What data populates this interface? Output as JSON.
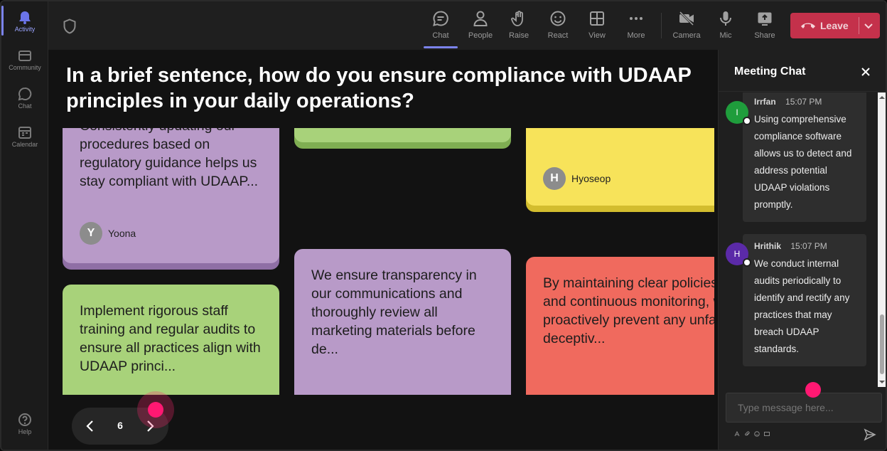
{
  "rail": {
    "items": [
      {
        "label": "Activity",
        "icon": "bell-icon",
        "active": true
      },
      {
        "label": "Community",
        "icon": "community-icon"
      },
      {
        "label": "Chat",
        "icon": "chat-icon"
      },
      {
        "label": "Calendar",
        "icon": "calendar-icon"
      }
    ],
    "help": {
      "label": "Help",
      "icon": "help-icon"
    }
  },
  "toolbar": {
    "buttons": [
      {
        "label": "Chat",
        "icon": "chat-icon",
        "active": true
      },
      {
        "label": "People",
        "icon": "people-icon"
      },
      {
        "label": "Raise",
        "icon": "raise-hand-icon"
      },
      {
        "label": "React",
        "icon": "smiley-icon"
      },
      {
        "label": "View",
        "icon": "grid-icon"
      },
      {
        "label": "More",
        "icon": "more-icon"
      },
      {
        "label": "Camera",
        "icon": "camera-off-icon"
      },
      {
        "label": "Mic",
        "icon": "mic-icon"
      },
      {
        "label": "Share",
        "icon": "share-icon"
      }
    ],
    "leave_label": "Leave"
  },
  "question": "In a brief sentence, how do you ensure compliance with UDAAP principles in your daily operations?",
  "cards": [
    {
      "text": "Consistently updating our procedures based on regulatory guidance helps us stay compliant with UDAAP...",
      "author_initial": "Y",
      "author": "Yoona",
      "color": "#b89ac8"
    },
    {
      "text": "",
      "color": "#a8d27a"
    },
    {
      "text": "",
      "author_initial": "H",
      "author": "Hyoseop",
      "color": "#f7e35a"
    },
    {
      "text": "Implement rigorous staff training and regular audits to ensure all practices align with UDAAP princi...",
      "color": "#a8d27a"
    },
    {
      "text": "We ensure transparency in our communications and thoroughly review all marketing materials before de...",
      "color": "#b89ac8"
    },
    {
      "text": "By maintaining clear policies and continuous monitoring, we proactively prevent any unfair, deceptiv...",
      "color": "#f06a5e"
    }
  ],
  "pager": {
    "page": "6"
  },
  "chat": {
    "title": "Meeting Chat",
    "messages": [
      {
        "initial": "I",
        "name": "Irrfan",
        "time": "15:07 PM",
        "text": "Using comprehensive compliance software allows us to detect and address potential UDAAP violations promptly.",
        "avatar_color": "#1f9d3c"
      },
      {
        "initial": "H",
        "name": "Hrithik",
        "time": "15:07 PM",
        "text": "We conduct internal audits periodically to identify and rectify any practices that may breach UDAAP standards.",
        "avatar_color": "#5b2aa8"
      }
    ],
    "input_placeholder": "Type message here..."
  },
  "colors": {
    "accent": "#7b83eb",
    "leave": "#c4314b",
    "cursor": "#ff1872"
  }
}
